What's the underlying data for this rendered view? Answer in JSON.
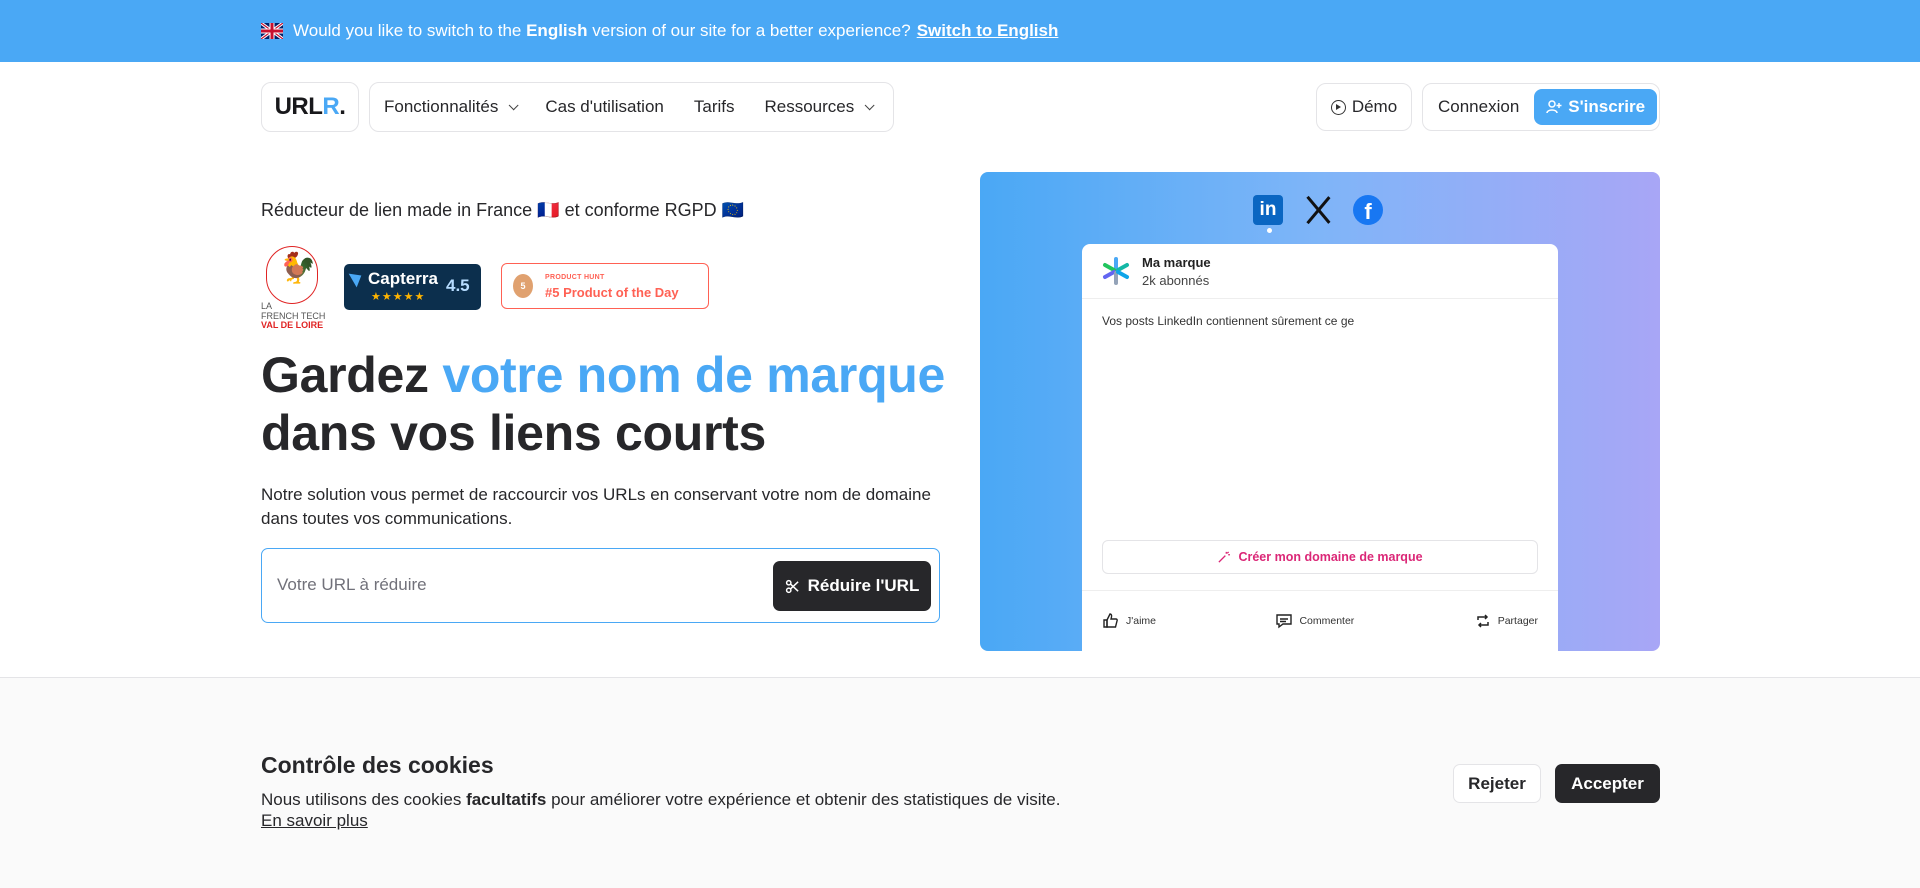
{
  "banner": {
    "text_before": "Would you like to switch to the",
    "text_bold": "English",
    "text_after": "version of our site for a better experience?",
    "link": "Switch to English",
    "flag_icon": "uk-flag-icon"
  },
  "nav": {
    "logo_main": "URL",
    "logo_accent": "R",
    "logo_dot": ".",
    "menu": [
      {
        "label": "Fonctionnalités",
        "dropdown": true
      },
      {
        "label": "Cas d'utilisation",
        "dropdown": false
      },
      {
        "label": "Tarifs",
        "dropdown": false
      },
      {
        "label": "Ressources",
        "dropdown": true
      }
    ],
    "demo_label": "Démo",
    "login_label": "Connexion",
    "signup_label": "S'inscrire"
  },
  "hero": {
    "tagline": "Réducteur de lien made in France 🇫🇷 et conforme RGPD 🇪🇺",
    "badges": {
      "frenchtech_line1": "LA",
      "frenchtech_line2": "FRENCH TECH",
      "frenchtech_line3": "VAL DE LOIRE",
      "capterra_name": "Capterra",
      "capterra_stars": "★★★★★",
      "capterra_score": "4.5",
      "ph_medal": "5",
      "ph_small": "PRODUCT HUNT",
      "ph_big": "#5 Product of the Day"
    },
    "title_part1": "Gardez ",
    "title_highlight": "votre nom de marque",
    "title_part2": "dans vos liens courts",
    "description": "Notre solution vous permet de raccourcir vos URLs en conservant votre nom de domaine dans toutes vos communications.",
    "input_placeholder": "Votre URL à réduire",
    "input_value": "",
    "button_label": "Réduire l'URL"
  },
  "preview": {
    "networks": [
      "linkedin-icon",
      "x-icon",
      "facebook-icon"
    ],
    "active_network": "linkedin",
    "linkedin_glyph": "in",
    "facebook_glyph": "f",
    "brand_name": "Ma marque",
    "followers": "2k abonnés",
    "post_text": "Vos posts LinkedIn contiennent sûrement ce ge",
    "cta_label": "Créer mon domaine de marque",
    "actions": [
      "J'aime",
      "Commenter",
      "Partager"
    ]
  },
  "cookies": {
    "title": "Contrôle des cookies",
    "text_before": "Nous utilisons des cookies",
    "text_bold": "facultatifs",
    "text_after": "pour améliorer votre expérience et obtenir des statistiques de visite.",
    "link": "En savoir plus",
    "reject_label": "Rejeter",
    "accept_label": "Accepter"
  },
  "colors": {
    "accent": "#4aa8f5",
    "dark": "#27272a",
    "pink": "#db2777",
    "producthunt": "#ff6154"
  }
}
